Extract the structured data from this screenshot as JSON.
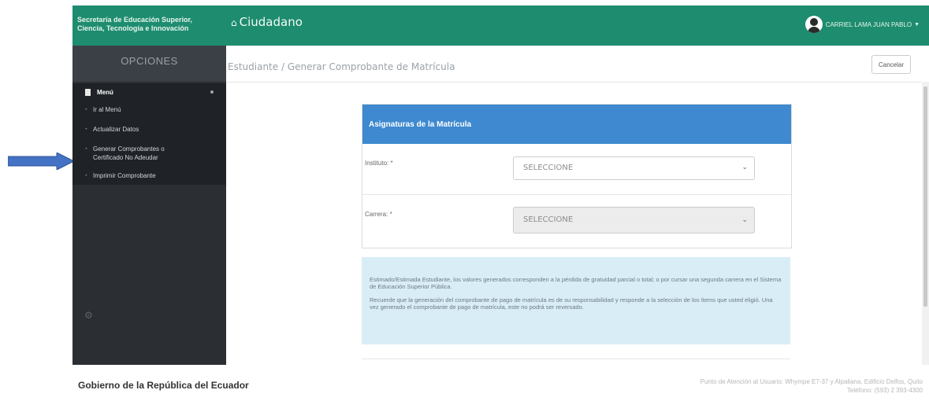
{
  "header": {
    "brand_line1": "Secretaría de Educación Superior,",
    "brand_line2": "Ciencia, Tecnología e Innovación",
    "home_label": "Ciudadano",
    "user_name": "CARRIEL LAMA JUAN PABLO",
    "bg_color": "#1e8c6e"
  },
  "sidebar": {
    "title": "OPCIONES",
    "menu_label": "Menú",
    "items": [
      {
        "label": "Ir al Menú"
      },
      {
        "label": "Actualizar Datos"
      },
      {
        "label": "Generar Comprobantes o Certificado No Adeudar"
      },
      {
        "label": "Imprimir Comprobante"
      }
    ]
  },
  "main": {
    "breadcrumb": "Estudiante / Generar Comprobante de Matrícula",
    "cancel_label": "Cancelar",
    "card_title": "Asignaturas de la Matrícula",
    "instituto_label": "Instituto: *",
    "instituto_value": "SELECCIONE",
    "carrera_label": "Carrera: *",
    "carrera_value": "SELECCIONE",
    "info_p1": "Estimado/Estimada Estudiante, los valores generados corresponden a la pérdida de gratuidad parcial o total; o por cursar una segunda carrera en el Sistema de Educación Superior Pública.",
    "info_p2": "Recuerde que la generación del comprobante de pago de matrícula es de su responsabilidad y responde a la selección de los ítems que usted eligió. Una vez generado el comprobante de pago de matrícula, este no podrá ser reversado.",
    "accent_color": "#3e89cf",
    "info_bg": "#d9edf7"
  },
  "footer": {
    "org": "Gobierno de la República del Ecuador",
    "address_line1": "Punto de Atención al Usuario: Whympe E7-37 y Alpallana, Edificio Delfos, Quito",
    "address_line2": "Teléfono: (593) 2 393-4300"
  },
  "annotation": {
    "arrow_color": "#4472c4"
  }
}
